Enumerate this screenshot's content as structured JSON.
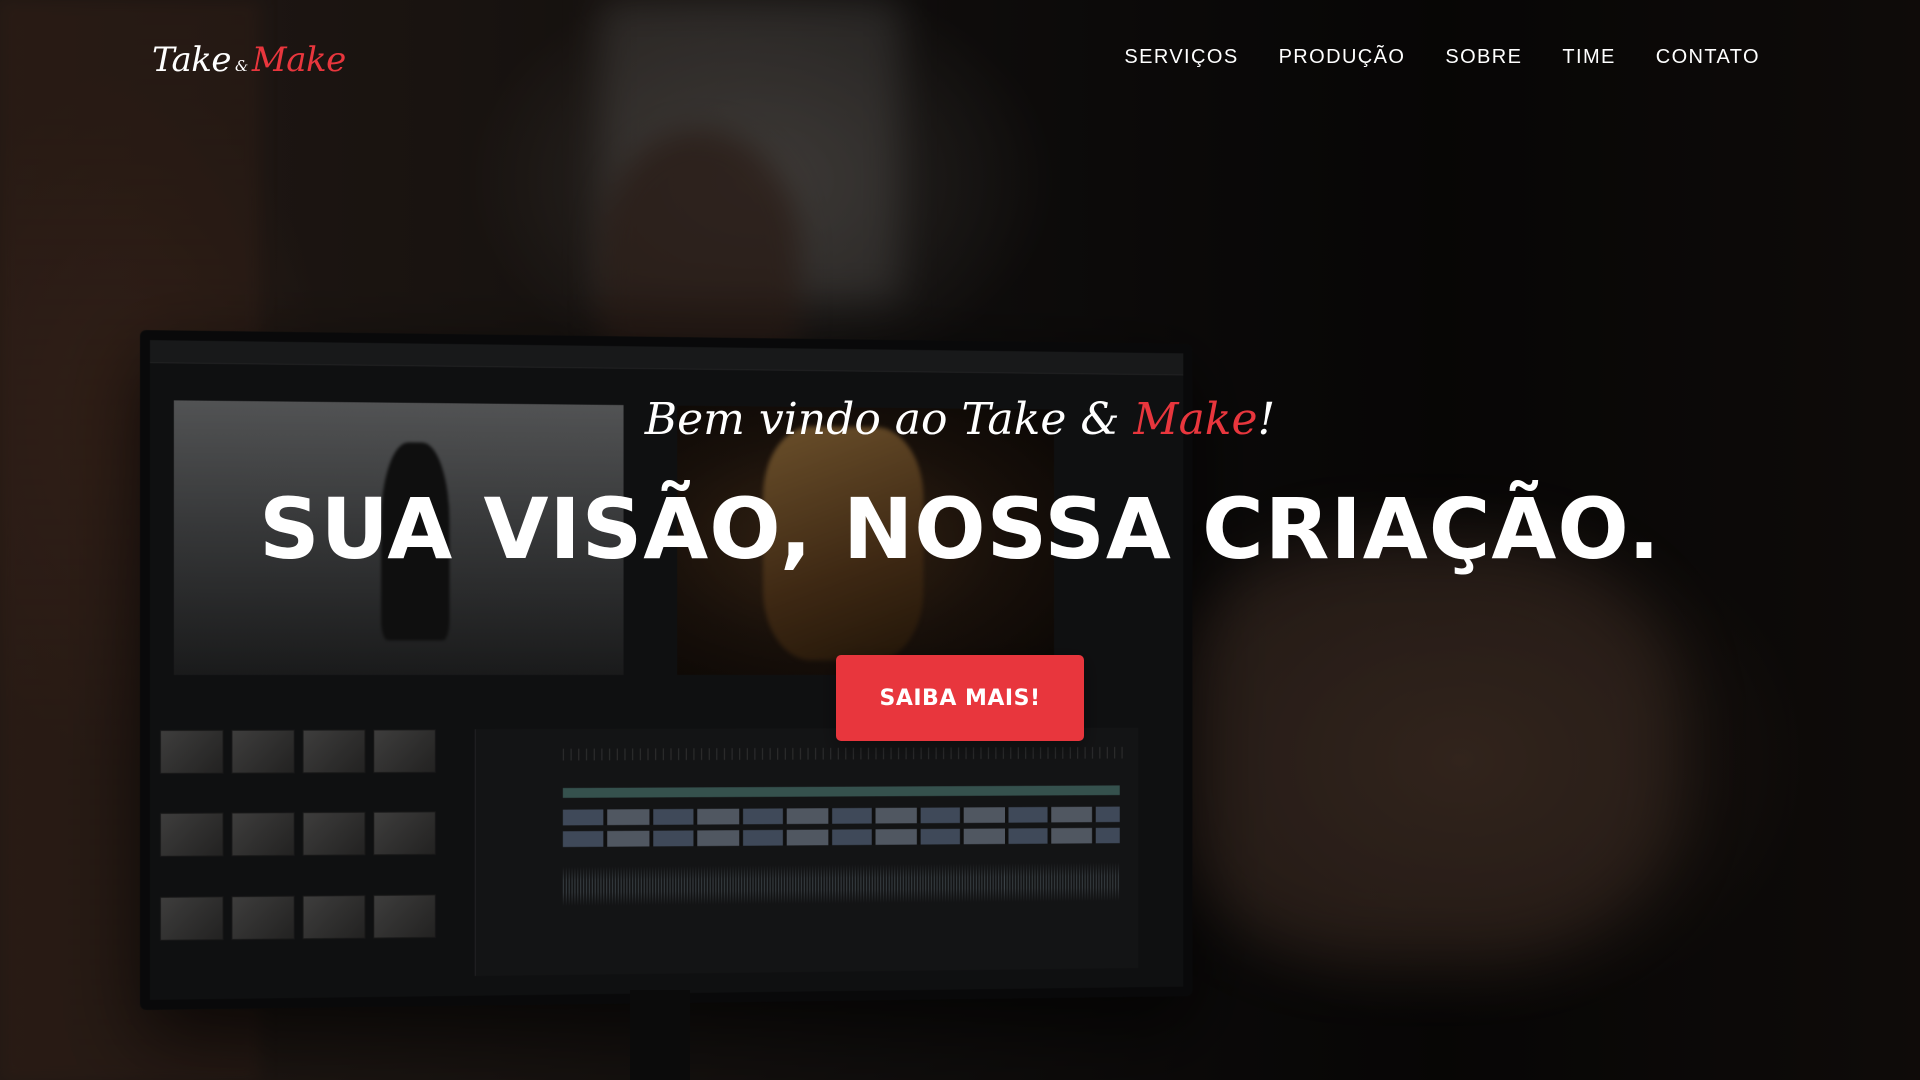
{
  "brand": {
    "logo_part1": "Take",
    "logo_amp": "&",
    "logo_part2": "Make",
    "accent_color": "#e8363d"
  },
  "nav": {
    "items": [
      {
        "label": "SERVIÇOS"
      },
      {
        "label": "PRODUÇÃO"
      },
      {
        "label": "SOBRE"
      },
      {
        "label": "TIME"
      },
      {
        "label": "CONTATO"
      }
    ]
  },
  "hero": {
    "welcome_prefix": "Bem vindo ao Take & ",
    "welcome_accent": "Make",
    "welcome_suffix": "!",
    "headline": "SUA VISÃO, NOSSA CRIAÇÃO.",
    "cta_label": "SAIBA MAIS!",
    "background_image": "video-editing-monitor-photo"
  }
}
